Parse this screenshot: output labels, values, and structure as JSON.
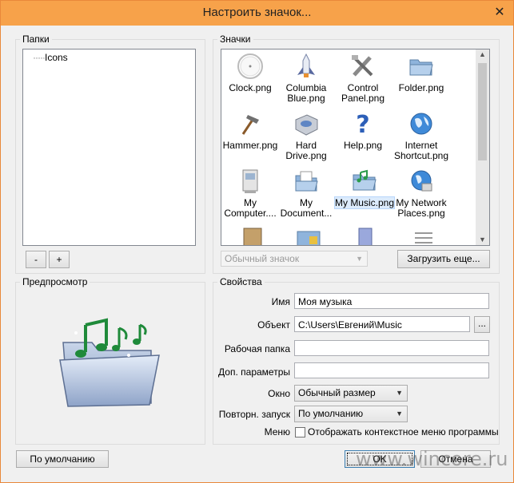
{
  "window": {
    "title": "Настроить значок...",
    "close_glyph": "✕"
  },
  "folders": {
    "label": "Папки",
    "tree": [
      {
        "label": "Icons"
      }
    ],
    "remove_label": "-",
    "add_label": "+"
  },
  "icons": {
    "label": "Значки",
    "items": [
      {
        "label": "Clock.png",
        "icon": "clock-icon"
      },
      {
        "label": "Columbia Blue.png",
        "icon": "shuttle-icon"
      },
      {
        "label": "Control Panel.png",
        "icon": "tools-icon"
      },
      {
        "label": "Folder.png",
        "icon": "folder-icon"
      },
      {
        "label": "Hammer.png",
        "icon": "hammer-icon"
      },
      {
        "label": "Hard Drive.png",
        "icon": "hard-drive-icon"
      },
      {
        "label": "Help.png",
        "icon": "help-icon"
      },
      {
        "label": "Internet Shortcut.png",
        "icon": "globe-icon"
      },
      {
        "label": "My Computer....",
        "icon": "computer-icon"
      },
      {
        "label": "My Document...",
        "icon": "documents-icon"
      },
      {
        "label": "My Music.png",
        "icon": "music-folder-icon",
        "selected": true
      },
      {
        "label": "My Network Places.png",
        "icon": "network-icon"
      }
    ],
    "icon_type_value": "Обычный значок",
    "load_more_label": "Загрузить еще..."
  },
  "preview": {
    "label": "Предпросмотр",
    "icon": "music-folder-icon"
  },
  "properties": {
    "label": "Свойства",
    "name_label": "Имя",
    "name_value": "Моя музыка",
    "target_label": "Объект",
    "target_value": "C:\\Users\\Евгений\\Music",
    "browse_label": "...",
    "workdir_label": "Рабочая папка",
    "workdir_value": "",
    "args_label": "Доп. параметры",
    "args_value": "",
    "window_label": "Окно",
    "window_value": "Обычный размер",
    "restart_label": "Повторн. запуск",
    "restart_value": "По умолчанию",
    "menu_label": "Меню",
    "menu_checkbox_label": "Отображать контекстное меню программы"
  },
  "footer": {
    "default_label": "По умолчанию",
    "ok_label": "OK",
    "cancel_label": "Отмена"
  },
  "watermark": "www.wincore.ru"
}
